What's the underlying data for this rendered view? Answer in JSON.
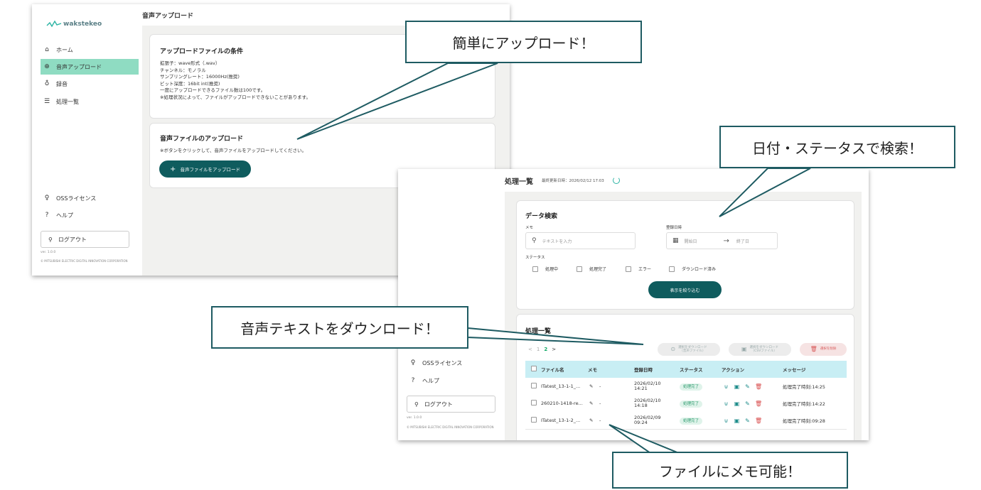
{
  "app": {
    "logo_text": "wakstekeo",
    "nav": [
      {
        "label": "ホーム",
        "icon": "home-icon"
      },
      {
        "label": "音声アップロード",
        "icon": "upload-icon"
      },
      {
        "label": "録音",
        "icon": "microphone-icon"
      },
      {
        "label": "処理一覧",
        "icon": "list-icon"
      }
    ],
    "oss_label": "OSSライセンス",
    "help_label": "ヘルプ",
    "logout_label": "ログアウト",
    "version": "ver. 1.0.0",
    "copyright": "© MITSUBISHI ELECTRIC DIGITAL INNOVATION CORPORATION"
  },
  "upload_page": {
    "title": "音声アップロード",
    "conditions_title": "アップロードファイルの条件",
    "conditions": [
      "拡張子：wave形式（.wav）",
      "チャンネル：モノラル",
      "サンプリングレート：16000Hz(推奨)",
      "ビット深度：16bit int(推奨)",
      "一度にアップロードできるファイル数は100です。",
      "※処理状況によって、ファイルがアップロードできないことがあります。"
    ],
    "upload_title": "音声ファイルのアップロード",
    "upload_desc": "※ボタンをクリックして、音声ファイルをアップロードしてください。",
    "upload_button": "音声ファイルをアップロード"
  },
  "list_page": {
    "title": "処理一覧",
    "last_updated": "最終更新日時：2026/02/12 17:03",
    "search_title": "データ検索",
    "memo_label": "メモ",
    "memo_placeholder": "テキストを入力",
    "date_label": "登録日時",
    "start_placeholder": "開始日",
    "end_placeholder": "終了日",
    "status_label": "ステータス",
    "status_options": [
      "処理中",
      "処理完了",
      "エラー",
      "ダウンロード済み"
    ],
    "filter_button": "表示を絞り込む",
    "list_title": "処理一覧",
    "dl_audio_button": [
      "選択をダウンロード",
      "（音声ファイル）"
    ],
    "dl_csv_button": [
      "選択をダウンロード",
      "（CSVファイル）"
    ],
    "delete_button": "選択を削除",
    "pager": {
      "prev": "<",
      "pages": [
        "1",
        "2"
      ],
      "current": "2",
      "next": ">"
    },
    "columns": [
      "ファイル名",
      "メモ",
      "登録日時",
      "ステータス",
      "アクション",
      "メッセージ"
    ],
    "rows": [
      {
        "file": "ITatest_13-1-1_...",
        "memo": "-",
        "date": "2026/02/10",
        "time": "14:21",
        "status": "処理完了",
        "message": "処理完了時刻:14:25"
      },
      {
        "file": "260210-1418-re...",
        "memo": "-",
        "date": "2026/02/10",
        "time": "14:18",
        "status": "処理完了",
        "message": "処理完了時刻:14:22"
      },
      {
        "file": "ITatest_13-1-2_...",
        "memo": "-",
        "date": "2026/02/09",
        "time": "09:24",
        "status": "処理完了",
        "message": "処理完了時刻:09:28"
      }
    ]
  },
  "callouts": {
    "easy_upload": "簡単にアップロード！",
    "search": "日付・ステータスで検索！",
    "download_text": "音声テキストをダウンロード！",
    "memo": "ファイルにメモ可能！"
  },
  "colors": {
    "accent": "#0f5c5e",
    "active_nav": "#8fdcc2",
    "callout_border": "#1e5b62",
    "table_header": "#c8eef4",
    "status_badge": "#dff3ea"
  }
}
